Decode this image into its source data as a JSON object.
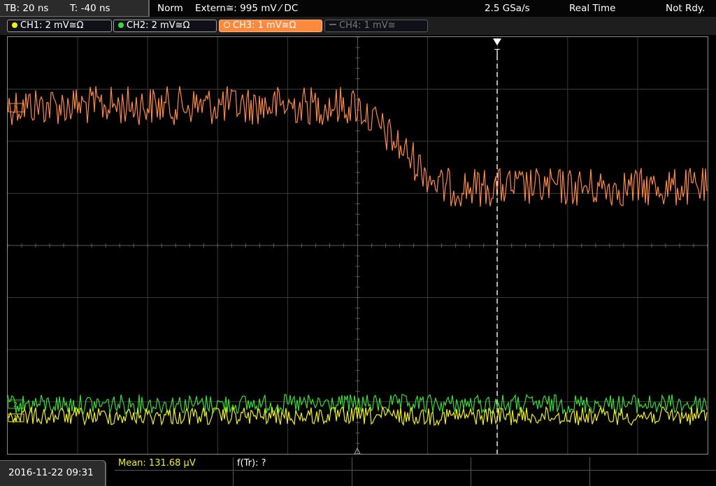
{
  "status": {
    "timebase": "TB: 20 ns",
    "trigger_time": "T: -40 ns",
    "trigger_mode": "Norm",
    "trigger_source": "Extern≅: 995 mV ⁄ DC",
    "sample_rate": "2.5 GSa/s",
    "acq_mode": "Real Time",
    "state": "Not Rdy."
  },
  "channels": [
    {
      "label": "CH1: 2 mV≅Ω",
      "color": "#f2f200"
    },
    {
      "label": "CH2: 2 mV≅Ω",
      "color": "#33dd33"
    },
    {
      "label": "CH3: 1 mV≅Ω",
      "color": "#ff8a3d"
    },
    {
      "label": "CH4: 1 mV≅",
      "color": "#777777"
    }
  ],
  "trigger_marker": "T",
  "markers": {
    "ch3": "3",
    "ch2": "2",
    "ch1": "1"
  },
  "measurements": {
    "mean": "Mean: 131.68 µV",
    "rise_freq": "f(Tr): ?"
  },
  "datetime": "2016-11-22 09:31",
  "colors": {
    "ch1": "#f2f200",
    "ch2": "#33dd33",
    "ch3": "#ff8a3d",
    "grid": "#4a4a4a"
  }
}
